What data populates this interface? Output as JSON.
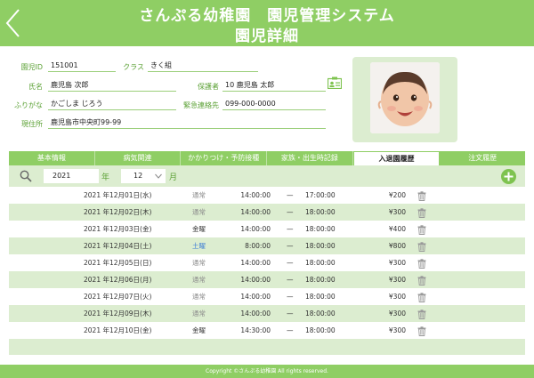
{
  "header": {
    "title": "さんぷる幼稚園　園児管理システム",
    "subtitle": "園児詳細"
  },
  "info": {
    "id_label": "園児ID",
    "id_value": "151001",
    "class_label": "クラス",
    "class_value": "きく組",
    "name_label": "氏名",
    "name_value": "鹿児島 次郎",
    "guardian_label": "保護者",
    "guardian_value": "10 鹿児島 太郎",
    "kana_label": "ふりがな",
    "kana_value": "かごしま じろう",
    "emergency_label": "緊急連絡先",
    "emergency_value": "099-000-0000",
    "address_label": "現住所",
    "address_value": "鹿児島市中央町99-99"
  },
  "tabs": [
    {
      "label": "基本情報",
      "active": false
    },
    {
      "label": "病気関連",
      "active": false
    },
    {
      "label": "かかりつけ・予防接種",
      "active": false
    },
    {
      "label": "家族・出生時記録",
      "active": false
    },
    {
      "label": "入退園履歴",
      "active": true
    },
    {
      "label": "注文履歴",
      "active": false
    }
  ],
  "filter": {
    "year": "2021",
    "year_suffix": "年",
    "month": "12",
    "month_suffix": "月"
  },
  "rows": [
    {
      "date": "2021 年12月01日(水)",
      "type": "通常",
      "in": "14:00:00",
      "dash": "—",
      "out": "17:00:00",
      "price": "¥200"
    },
    {
      "date": "2021 年12月02日(木)",
      "type": "通常",
      "in": "14:00:00",
      "dash": "—",
      "out": "18:00:00",
      "price": "¥300"
    },
    {
      "date": "2021 年12月03日(金)",
      "type": "金曜",
      "in": "14:00:00",
      "dash": "—",
      "out": "18:00:00",
      "price": "¥400"
    },
    {
      "date": "2021 年12月04日(土)",
      "type": "土曜",
      "in": "8:00:00",
      "dash": "—",
      "out": "18:00:00",
      "price": "¥800"
    },
    {
      "date": "2021 年12月05日(日)",
      "type": "通常",
      "in": "14:00:00",
      "dash": "—",
      "out": "18:00:00",
      "price": "¥300"
    },
    {
      "date": "2021 年12月06日(月)",
      "type": "通常",
      "in": "14:00:00",
      "dash": "—",
      "out": "18:00:00",
      "price": "¥300"
    },
    {
      "date": "2021 年12月07日(火)",
      "type": "通常",
      "in": "14:00:00",
      "dash": "—",
      "out": "18:00:00",
      "price": "¥300"
    },
    {
      "date": "2021 年12月09日(木)",
      "type": "通常",
      "in": "14:00:00",
      "dash": "—",
      "out": "18:00:00",
      "price": "¥300"
    },
    {
      "date": "2021 年12月10日(金)",
      "type": "金曜",
      "in": "14:30:00",
      "dash": "—",
      "out": "18:00:00",
      "price": "¥300"
    }
  ],
  "footer": "Copyright ©さんぷる幼稚園 All rights reserved.",
  "colors": {
    "accent": "#8fce64",
    "band": "#dcedd0",
    "label": "#5aa033",
    "saturday": "#3a7bd5"
  },
  "icons": {
    "back": "chevron-left-icon",
    "card": "id-card-icon",
    "search": "search-icon",
    "add": "plus-circle-icon",
    "trash": "trash-icon",
    "dropdown": "chevron-down-icon"
  }
}
